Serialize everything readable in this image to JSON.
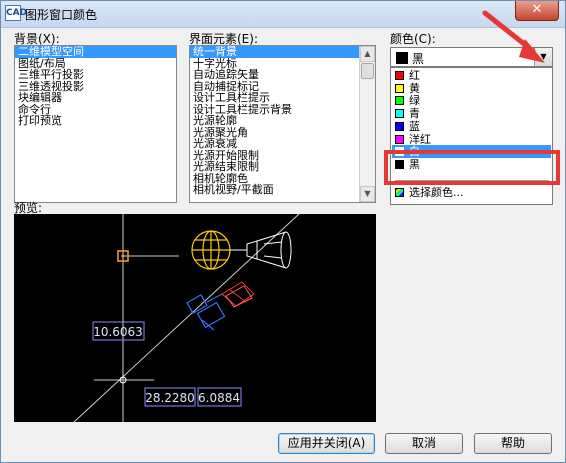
{
  "window": {
    "title": "图形窗口颜色",
    "app_icon_text": "CAD",
    "close_label": "✕"
  },
  "context": {
    "label": "背景(X):",
    "items": [
      "二维模型空间",
      "图纸/布局",
      "三维平行投影",
      "三维透视投影",
      "块编辑器",
      "命令行",
      "打印预览"
    ],
    "selected_index": 0
  },
  "elements": {
    "label": "界面元素(E):",
    "items": [
      "统一背景",
      "十字光标",
      "自动追踪矢量",
      "自动捕捉标记",
      "设计工具栏提示",
      "设计工具栏提示背景",
      "光源轮廓",
      "光源聚光角",
      "光源衰减",
      "光源开始限制",
      "光源结束限制",
      "相机轮廓色",
      "相机视野/平截面"
    ],
    "selected_index": 0
  },
  "color": {
    "label": "颜色(C):",
    "selected_value": "黑",
    "selected_swatch": "#000000",
    "options": [
      {
        "label": "红",
        "swatch": "#ff0000"
      },
      {
        "label": "黄",
        "swatch": "#ffff00"
      },
      {
        "label": "绿",
        "swatch": "#00ff00"
      },
      {
        "label": "青",
        "swatch": "#00ffff"
      },
      {
        "label": "蓝",
        "swatch": "#0000ff"
      },
      {
        "label": "洋红",
        "swatch": "#ff00ff"
      },
      {
        "label": "白",
        "swatch": "#ffffff"
      },
      {
        "label": "黑",
        "swatch": "#000000"
      }
    ],
    "highlighted_index": 6,
    "select_color_label": "选择颜色..."
  },
  "preview": {
    "label": "预览:",
    "dim_vertical": "10.6063",
    "dim_x": "28.2280",
    "dim_y": "6.0884"
  },
  "buttons": {
    "apply_close": "应用并关闭(A)",
    "cancel": "取消",
    "help": "帮助"
  },
  "colors": {
    "highlight_box": "#e53935",
    "annotation_arrow": "#e53935",
    "selection": "#3399ff",
    "preview_bg": "#000000"
  }
}
